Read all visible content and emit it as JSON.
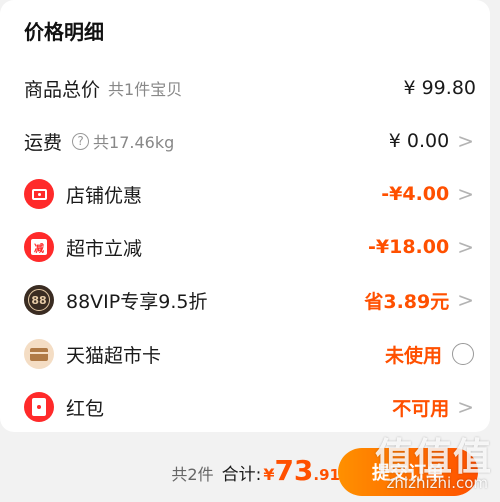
{
  "header": {
    "title": "价格明细"
  },
  "rows": {
    "goods_total": {
      "label": "商品总价",
      "sub": "共1件宝贝",
      "value": "¥ 99.80"
    },
    "shipping": {
      "label": "运费",
      "help": "?",
      "sub": "共17.46kg",
      "value": "¥ 0.00",
      "chevron": ">"
    },
    "shop_discount": {
      "label": "店铺优惠",
      "value": "-¥4.00",
      "chevron": ">",
      "icon": "ticket-icon"
    },
    "market_reduce": {
      "label": "超市立减",
      "icon_text": "减",
      "value": "-¥18.00",
      "chevron": ">",
      "icon": "reduce-icon"
    },
    "vip": {
      "label": "88VIP专享9.5折",
      "icon_text": "88",
      "value": "省3.89元",
      "chevron": ">",
      "icon": "88vip-icon"
    },
    "tmall_card": {
      "label": "天猫超市卡",
      "value": "未使用",
      "icon": "card-icon"
    },
    "red_packet": {
      "label": "红包",
      "value": "不可用",
      "chevron": ">",
      "icon": "red-packet-icon"
    }
  },
  "footer": {
    "count": "共2件",
    "sum_label": "合计:",
    "currency": "¥",
    "amount_int": "73",
    "amount_dec": ".91",
    "submit_label": "提交订单"
  },
  "watermark": {
    "main": "值值值",
    "sub": "zhizhizhi.com"
  },
  "colors": {
    "accent": "#ff5000",
    "icon_red": "#ff2a2a"
  }
}
